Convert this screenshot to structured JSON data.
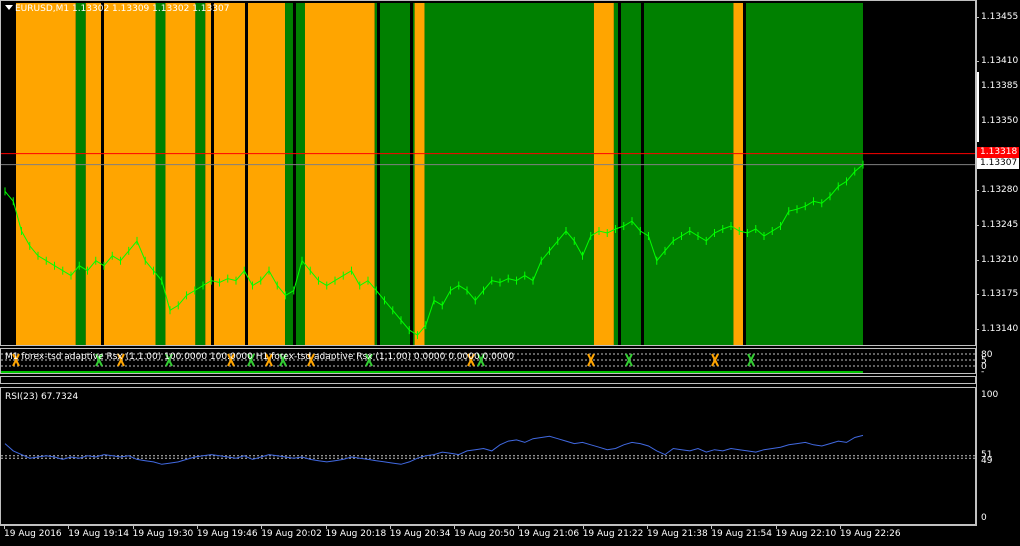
{
  "chart_title": "EURUSD,M1  1.13302 1.13309 1.13302 1.13307",
  "price_scale": [
    "1.13455",
    "1.13410",
    "1.13385",
    "1.13350",
    "1.13318",
    "1.13307",
    "1.13280",
    "1.13245",
    "1.13210",
    "1.13175",
    "1.13140"
  ],
  "price_line_label": "1.13318",
  "current_price_label": "1.13307",
  "indicator1_label": "M1 forex-tsd adaptive Rsx (1,1.00) 100.0000 100.0000 H1 forex-tsd adaptive Rsx (1,1.00) 0.0000 0.0000 0.0000",
  "indicator1_scale": [
    "80",
    "5",
    "0",
    "-"
  ],
  "rsi_label": "RSI(23) 67.7324",
  "rsi_scale": [
    "100",
    "51",
    "49",
    "0"
  ],
  "time_labels": [
    "19 Aug 2016",
    "19 Aug 19:14",
    "19 Aug 19:30",
    "19 Aug 19:46",
    "19 Aug 20:02",
    "19 Aug 20:18",
    "19 Aug 20:34",
    "19 Aug 20:50",
    "19 Aug 21:06",
    "19 Aug 21:22",
    "19 Aug 21:38",
    "19 Aug 21:54",
    "19 Aug 22:10",
    "19 Aug 22:26"
  ],
  "colors": {
    "up_zone": "#008000",
    "down_zone": "#ffa500",
    "price_line": "#ff0000",
    "candles": "#00ff00",
    "rsi": "#4169e1",
    "background": "#000000"
  },
  "chart_data": {
    "type": "line",
    "title": "EURUSD,M1",
    "series": [
      {
        "name": "EURUSD,M1",
        "values": [
          1.1328,
          1.1327,
          1.1324,
          1.13225,
          1.13215,
          1.1321,
          1.13205,
          1.132,
          1.13195,
          1.13205,
          1.132,
          1.1321,
          1.13205,
          1.13215,
          1.1321,
          1.1322,
          1.1323,
          1.1321,
          1.132,
          1.1319,
          1.1316,
          1.13165,
          1.13175,
          1.1318,
          1.13185,
          1.1319,
          1.13188,
          1.13192,
          1.1319,
          1.132,
          1.13185,
          1.1319,
          1.132,
          1.13185,
          1.13175,
          1.1318,
          1.1321,
          1.132,
          1.1319,
          1.13185,
          1.1319,
          1.13195,
          1.132,
          1.13185,
          1.1319,
          1.1318,
          1.1317,
          1.1316,
          1.1315,
          1.1314,
          1.13135,
          1.13145,
          1.1317,
          1.13165,
          1.1318,
          1.13185,
          1.1318,
          1.1317,
          1.1318,
          1.1319,
          1.13188,
          1.13192,
          1.1319,
          1.13195,
          1.1319,
          1.1321,
          1.1322,
          1.1323,
          1.1324,
          1.1323,
          1.13215,
          1.13235,
          1.1324,
          1.13238,
          1.13242,
          1.13245,
          1.1325,
          1.1324,
          1.13235,
          1.1321,
          1.1322,
          1.1323,
          1.13235,
          1.1324,
          1.13235,
          1.1323,
          1.13238,
          1.13242,
          1.13245,
          1.1324,
          1.13238,
          1.13242,
          1.13235,
          1.1324,
          1.13245,
          1.1326,
          1.13262,
          1.13265,
          1.1327,
          1.13268,
          1.13275,
          1.13285,
          1.1329,
          1.133,
          1.13307
        ]
      }
    ],
    "ylim": [
      1.13125,
      1.1347
    ]
  },
  "rsi_data": {
    "values": [
      61,
      55,
      52,
      49,
      50,
      51,
      50,
      48,
      50,
      49,
      51,
      50,
      52,
      51,
      50,
      51,
      48,
      47,
      46,
      44,
      45,
      46,
      48,
      50,
      51,
      52,
      51,
      50,
      49,
      51,
      48,
      50,
      52,
      51,
      50,
      49,
      50,
      48,
      47,
      46,
      47,
      48,
      50,
      49,
      48,
      47,
      46,
      45,
      44,
      46,
      49,
      51,
      52,
      54,
      53,
      52,
      55,
      56,
      57,
      55,
      60,
      63,
      64,
      62,
      65,
      66,
      67,
      65,
      63,
      61,
      62,
      60,
      58,
      56,
      57,
      60,
      62,
      61,
      59,
      55,
      52,
      57,
      56,
      55,
      57,
      54,
      56,
      55,
      57,
      56,
      55,
      54,
      56,
      57,
      58,
      60,
      61,
      62,
      60,
      59,
      61,
      63,
      62,
      66,
      67.7324
    ],
    "ylim": [
      0,
      100
    ],
    "levels": [
      51,
      49
    ]
  },
  "zones": [
    {
      "color": "down",
      "from": 0,
      "to": 6
    },
    {
      "color": "up",
      "from": 6,
      "to": 7
    },
    {
      "color": "down",
      "from": 7,
      "to": 14
    },
    {
      "color": "up",
      "from": 14,
      "to": 15
    },
    {
      "color": "down",
      "from": 15,
      "to": 18
    },
    {
      "color": "up",
      "from": 18,
      "to": 19
    },
    {
      "color": "down",
      "from": 19,
      "to": 27
    },
    {
      "color": "up",
      "from": 27,
      "to": 29
    },
    {
      "color": "down",
      "from": 29,
      "to": 36
    },
    {
      "color": "up",
      "from": 36,
      "to": 40
    },
    {
      "color": "down",
      "from": 40,
      "to": 41
    },
    {
      "color": "up",
      "from": 41,
      "to": 58
    },
    {
      "color": "down",
      "from": 58,
      "to": 60
    },
    {
      "color": "up",
      "from": 60,
      "to": 63
    },
    {
      "color": "up",
      "from": 63,
      "to": 72
    },
    {
      "color": "down",
      "from": 72,
      "to": 73
    },
    {
      "color": "up",
      "from": 73,
      "to": 85
    }
  ]
}
